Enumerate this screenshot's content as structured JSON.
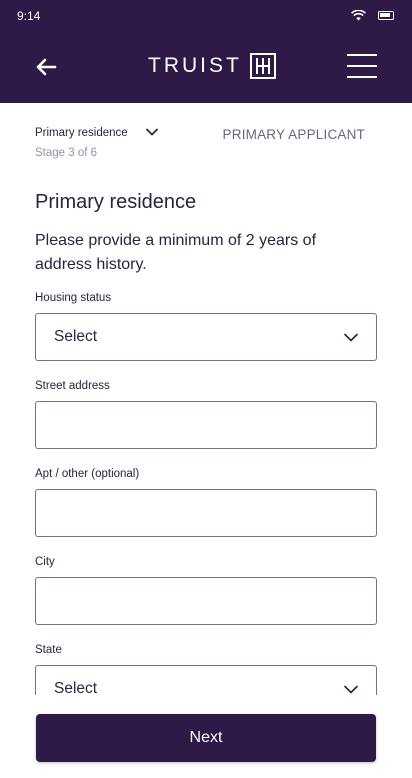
{
  "status_bar": {
    "time": "9:14",
    "wifi_icon": "wifi-icon",
    "battery_icon": "battery-icon"
  },
  "header": {
    "back_icon": "arrow-left-icon",
    "brand": "TRUIST",
    "brand_mark_icon": "truist-logo-mark",
    "menu_icon": "hamburger-menu-icon",
    "background": "#2e1a47"
  },
  "stage": {
    "title": "Primary residence",
    "subtitle": "Stage 3 of 6",
    "chevron_icon": "chevron-down-icon",
    "applicant": "PRIMARY APPLICANT"
  },
  "form": {
    "section_title": "Primary residence",
    "instructions": "Please provide a minimum of 2 years of address history.",
    "housing_status": {
      "label": "Housing status",
      "value": "Select"
    },
    "street_address": {
      "label": "Street address",
      "value": ""
    },
    "apt_other": {
      "label": "Apt / other (optional)",
      "value": ""
    },
    "city": {
      "label": "City",
      "value": ""
    },
    "state": {
      "label": "State",
      "value": "Select"
    }
  },
  "footer": {
    "next_label": "Next",
    "accent": "#2e1a47"
  }
}
